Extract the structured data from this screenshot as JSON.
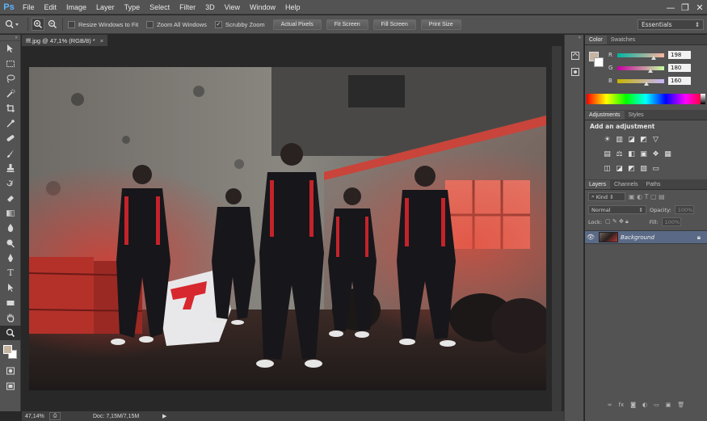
{
  "app": {
    "logo": "Ps"
  },
  "menu": [
    "File",
    "Edit",
    "Image",
    "Layer",
    "Type",
    "Select",
    "Filter",
    "3D",
    "View",
    "Window",
    "Help"
  ],
  "window_controls": {
    "minimize": "—",
    "restore": "❐",
    "close": "✕"
  },
  "options": {
    "tool_icon": "zoom-icon",
    "resize_windows_label": "Resize Windows to Fit",
    "zoom_all_label": "Zoom All Windows",
    "scrubby_zoom_label": "Scrubby Zoom",
    "scrubby_zoom_checked": true,
    "buttons": [
      "Actual Pixels",
      "Fit Screen",
      "Fill Screen",
      "Print Size"
    ],
    "workspace": "Essentials"
  },
  "document": {
    "tab_title": "fff.jpg @ 47,1% (RGB/8) *",
    "tab_close": "×"
  },
  "status": {
    "zoom": "47,14%",
    "doc_info": "Doc: 7,15M/7,15M"
  },
  "panels": {
    "color": {
      "tabs": [
        "Color",
        "Swatches"
      ],
      "fg": "#c6b4a0",
      "channels": [
        {
          "label": "R",
          "value": "198",
          "fraction": 0.776
        },
        {
          "label": "G",
          "value": "180",
          "fraction": 0.706
        },
        {
          "label": "B",
          "value": "160",
          "fraction": 0.627
        }
      ]
    },
    "adjustments": {
      "tabs": [
        "Adjustments",
        "Styles"
      ],
      "heading": "Add an adjustment"
    },
    "layers": {
      "tabs": [
        "Layers",
        "Channels",
        "Paths"
      ],
      "kind": "Kind",
      "blend_mode": "Normal",
      "opacity_label": "Opacity:",
      "opacity_value": "100%",
      "lock_label": "Lock:",
      "fill_label": "Fill:",
      "fill_value": "100%",
      "layer_name": "Background"
    }
  }
}
